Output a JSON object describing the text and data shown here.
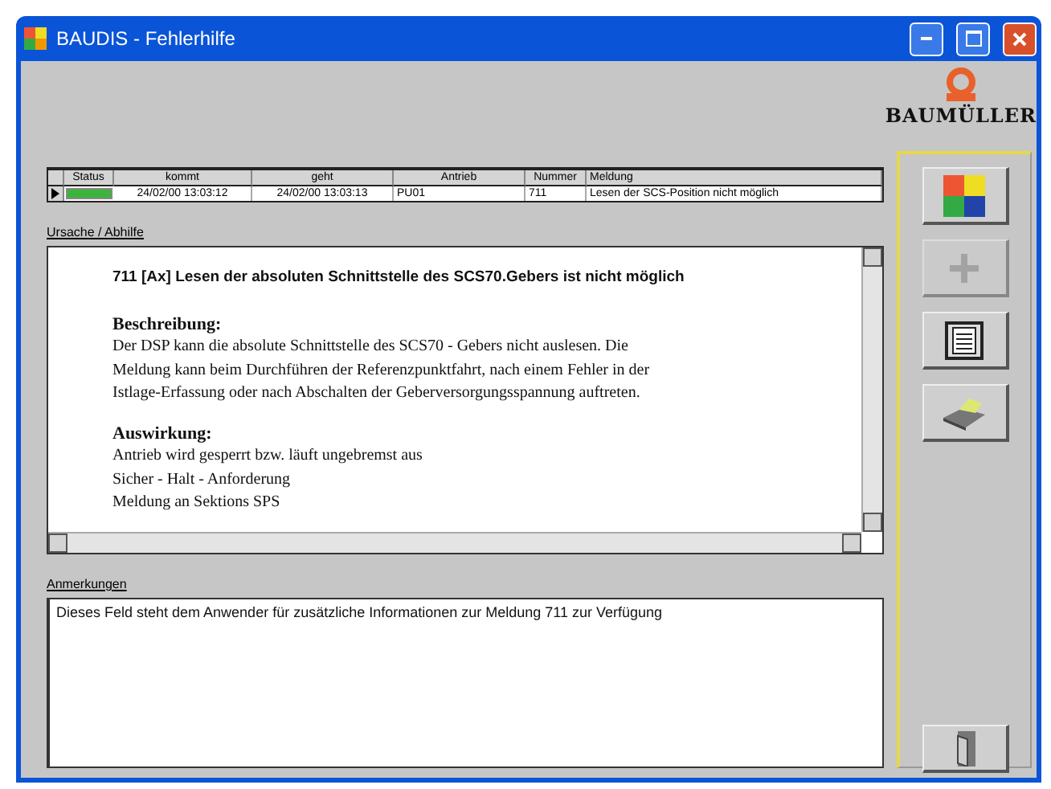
{
  "window": {
    "title": "BAUDIS - Fehlerhilfe"
  },
  "logo": {
    "text": "BAUMÜLLER"
  },
  "table": {
    "columns": [
      "Status",
      "kommt",
      "geht",
      "Antrieb",
      "Nummer",
      "Meldung"
    ],
    "rows": [
      {
        "selected": true,
        "color": "#3cb43c",
        "cells": [
          "",
          "24/02/00 13:03:12",
          "24/02/00 13:03:13",
          "PU01",
          "711",
          "Lesen der SCS-Position nicht möglich"
        ]
      }
    ]
  },
  "cause_label": "Ursache / Abhilfe",
  "help": {
    "heading": "711 [Ax] Lesen der absoluten Schnittstelle des SCS70.Gebers ist nicht möglich",
    "sections": [
      {
        "title": "Beschreibung:",
        "lines": [
          "Der DSP kann die absolute Schnittstelle des SCS70 - Gebers nicht auslesen. Die",
          "Meldung kann beim Durchführen der Referenzpunktfahrt, nach einem Fehler in der",
          "Istlage-Erfassung oder nach Abschalten der Geberversorgungsspannung auftreten."
        ]
      },
      {
        "title": "Auswirkung:",
        "lines": [
          "Antrieb wird gesperrt bzw. läuft ungebremst aus",
          "Sicher - Halt - Anforderung",
          "Meldung an Sektions SPS"
        ]
      }
    ]
  },
  "notes": {
    "label": "Anmerkungen",
    "value": "Dieses Feld steht dem Anwender für zusätzliche Informationen zur Meldung 711 zur Verfügung"
  },
  "toolbar": [
    {
      "kind": "puzzle",
      "disabled": false
    },
    {
      "kind": "plus",
      "disabled": true
    },
    {
      "kind": "document",
      "disabled": false
    },
    {
      "kind": "printer",
      "disabled": false
    }
  ],
  "exit": {
    "kind": "door"
  }
}
